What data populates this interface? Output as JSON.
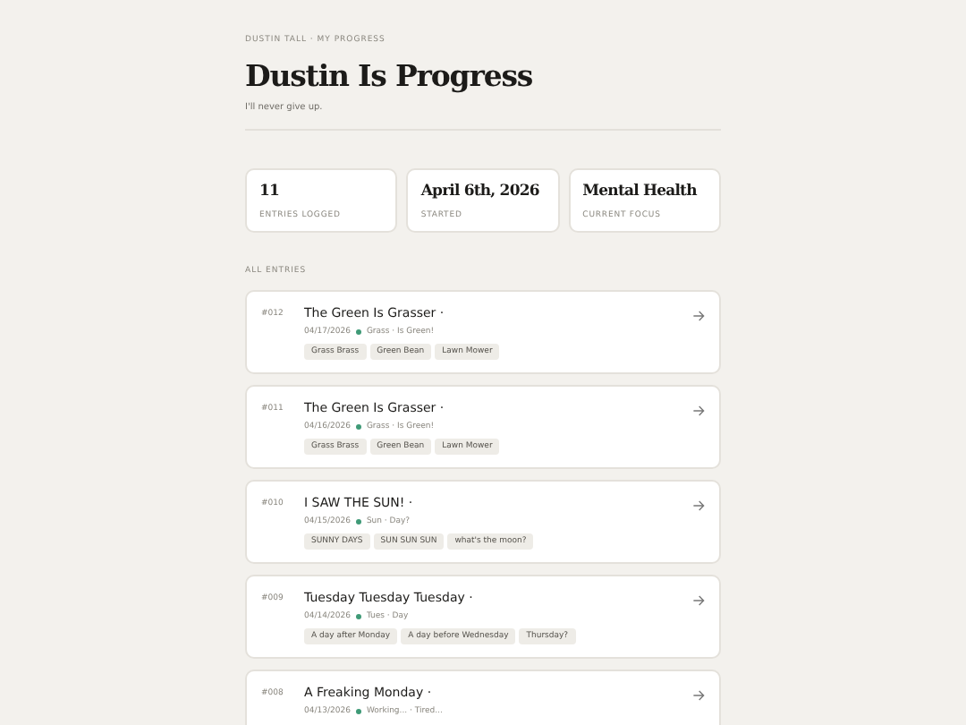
{
  "breadcrumb": "DUSTIN TALL · MY PROGRESS",
  "title": "Dustin Is Progress",
  "subtitle": "I'll never give up.",
  "stats": [
    {
      "value": "11",
      "label": "ENTRIES LOGGED"
    },
    {
      "value": "April 6th, 2026",
      "label": "STARTED"
    },
    {
      "value": "Mental Health",
      "label": "CURRENT FOCUS"
    }
  ],
  "section_label": "ALL ENTRIES",
  "entries": [
    {
      "number": "#012",
      "title": "The Green Is Grasser ·",
      "date": "04/17/2026",
      "mood": "Grass · Is Green!",
      "tags": [
        "Grass Brass",
        "Green Bean",
        "Lawn Mower"
      ]
    },
    {
      "number": "#011",
      "title": "The Green Is Grasser ·",
      "date": "04/16/2026",
      "mood": "Grass · Is Green!",
      "tags": [
        "Grass Brass",
        "Green Bean",
        "Lawn Mower"
      ]
    },
    {
      "number": "#010",
      "title": "I SAW THE SUN! ·",
      "date": "04/15/2026",
      "mood": "Sun · Day?",
      "tags": [
        "SUNNY DAYS",
        "SUN SUN SUN",
        "what's the moon?"
      ]
    },
    {
      "number": "#009",
      "title": "Tuesday Tuesday Tuesday ·",
      "date": "04/14/2026",
      "mood": "Tues · Day",
      "tags": [
        "A day after Monday",
        "A day before Wednesday",
        "Thursday?"
      ]
    },
    {
      "number": "#008",
      "title": "A Freaking Monday ·",
      "date": "04/13/2026",
      "mood": "Working... · Tired..."
    }
  ]
}
